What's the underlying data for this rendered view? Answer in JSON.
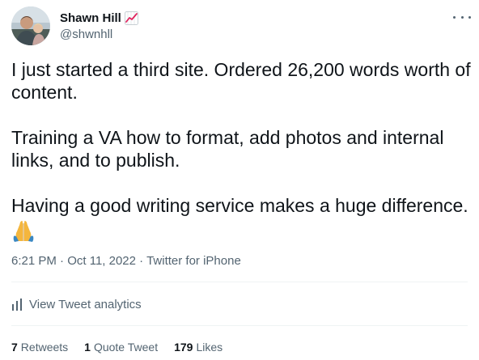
{
  "author": {
    "name": "Shawn Hill",
    "handle": "@shwnhll",
    "name_emoji_icon": "chart-increasing-icon",
    "avatar_icon": "avatar"
  },
  "tweet": {
    "paragraphs": [
      "I just started a third site. Ordered 26,200 words worth of content.",
      "Training a VA how to format, add photos and internal links, and to publish.",
      "Having a good writing service makes a huge difference."
    ],
    "trailing_emoji_icon": "folded-hands-icon"
  },
  "meta": {
    "time": "6:21 PM",
    "separator1": " · ",
    "date": "Oct 11, 2022",
    "separator2": " · ",
    "source": "Twitter for iPhone"
  },
  "analytics": {
    "label": "View Tweet analytics",
    "icon": "analytics-bars-icon"
  },
  "stats": [
    {
      "count": "7",
      "label": "Retweets"
    },
    {
      "count": "1",
      "label": "Quote Tweet"
    },
    {
      "count": "179",
      "label": "Likes"
    }
  ],
  "colors": {
    "text_primary": "#0f1419",
    "text_secondary": "#536471",
    "divider": "#eff3f4"
  }
}
